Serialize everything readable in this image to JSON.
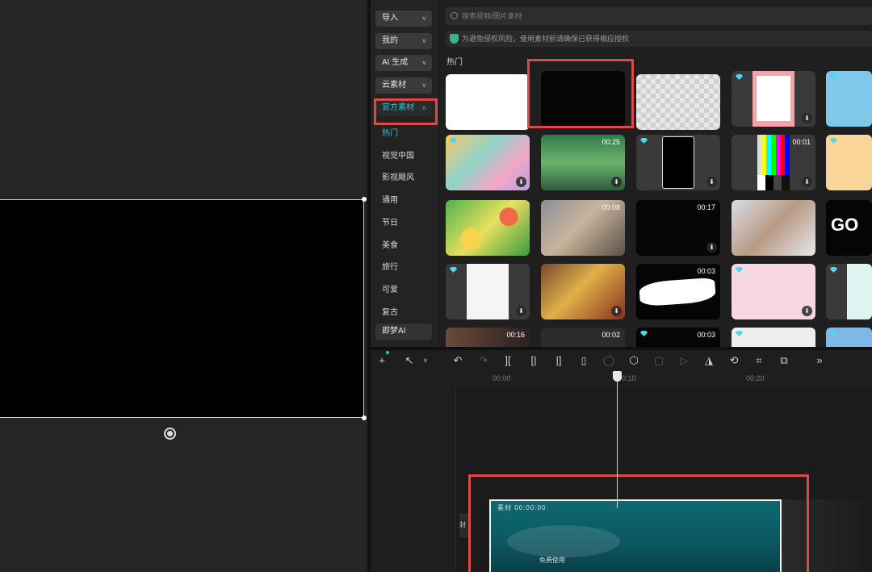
{
  "categories": {
    "dropdowns": [
      {
        "label": "导入",
        "chevron": "˅"
      },
      {
        "label": "我的",
        "chevron": "˅"
      },
      {
        "label": "AI 生成",
        "chevron": "˅"
      },
      {
        "label": "云素材",
        "chevron": "˅"
      },
      {
        "label": "官方素材",
        "chevron": "˄"
      }
    ],
    "subitems": [
      "热门",
      "视觉中国",
      "影视飓风",
      "通用",
      "节日",
      "美食",
      "旅行",
      "可爱",
      "复古"
    ],
    "ai_item": "即梦AI"
  },
  "materials": {
    "search_placeholder": "搜索视频/图片素材",
    "notice": "为避免侵权风险，使用素材前请确保已获得相应授权",
    "section_label": "热门",
    "durations": {
      "r1c2": "00:25",
      "r1c4": "00:01",
      "r2c2": "00:08",
      "r2c3": "00:17",
      "r3c3": "00:03",
      "r4c1": "00:16",
      "r4c2": "00:02",
      "r4c3": "00:03"
    }
  },
  "timeline": {
    "ticks": [
      "00:00",
      "00:10",
      "00:20"
    ],
    "clip_name": "素材 00:00:00",
    "clip_sub": "免费使用",
    "track_label": "封"
  },
  "colors": {
    "accent": "#26c6da",
    "highlight_box": "#e04848"
  },
  "icons": {
    "add": "+",
    "select": "↖",
    "undo": "↶",
    "redo": "↷",
    "split": "][",
    "split_left": "[|",
    "split_right": "|]",
    "delete": "🗑",
    "freeze": "◯",
    "mask": "⬡",
    "crop_frame": "▢",
    "play_reverse": "▷",
    "mirror": "◮",
    "rotate": "⟲",
    "crop": "⌗",
    "screen": "⧉",
    "more": "»"
  }
}
